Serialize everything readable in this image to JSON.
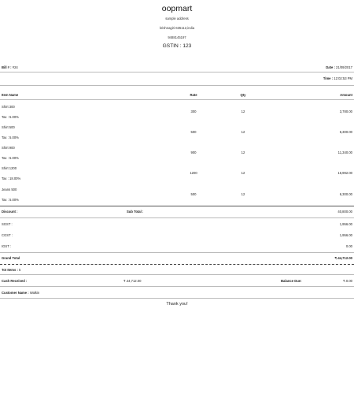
{
  "store": {
    "name": "oopmart",
    "address_line1": "sample address",
    "address_line2": "krishnagiri-635112,india",
    "phone": "9488145197",
    "gstin": "GSTIN : 123"
  },
  "bill": {
    "bill_no_label": "Bill # :",
    "bill_no_value": "#24",
    "date_label": "Date :",
    "date_value": "21/09/2017",
    "time_label": "Time :",
    "time_value": "12:02:53 PM"
  },
  "columns": {
    "name": "Item Name",
    "rate": "Rate",
    "qty": "Qty",
    "amount": "Amount"
  },
  "items": [
    {
      "name": "Shirt 300",
      "tax": "Tax : 5.00%",
      "rate": "300",
      "qty": "12",
      "amount": "3,780.00"
    },
    {
      "name": "Shirt 500",
      "tax": "Tax : 5.00%",
      "rate": "500",
      "qty": "12",
      "amount": "6,300.00"
    },
    {
      "name": "Shirt 900",
      "tax": "Tax : 5.00%",
      "rate": "900",
      "qty": "12",
      "amount": "11,340.00"
    },
    {
      "name": "Shirt 1200",
      "tax": "Tax : 18.00%",
      "rate": "1200",
      "qty": "12",
      "amount": "16,992.00"
    },
    {
      "name": "Jeans 500",
      "tax": "Tax : 5.00%",
      "rate": "500",
      "qty": "12",
      "amount": "6,300.00"
    }
  ],
  "summary": {
    "discount_label": "Discount :",
    "subtotal_label": "Sub Total :",
    "subtotal_value": "40,800.00",
    "sgst_label": "SGST :",
    "sgst_value": "1,956.00",
    "cgst_label": "CGST :",
    "cgst_value": "1,956.00",
    "igst_label": "IGST :",
    "igst_value": "0.00",
    "grand_total_label": "Grand Total",
    "grand_total_value": "₹.44,712.00",
    "tot_items_label": "Tot Items :",
    "tot_items_value": "5",
    "cash_received_label": "Cash Received :",
    "cash_received_value": "₹.44,712.00",
    "balance_due_label": "Balance Due:",
    "balance_due_value": "₹.0.00",
    "customer_name_label": "Customer Name :",
    "customer_name_value": "Walkin"
  },
  "footer": {
    "thanks": "Thank you!"
  }
}
